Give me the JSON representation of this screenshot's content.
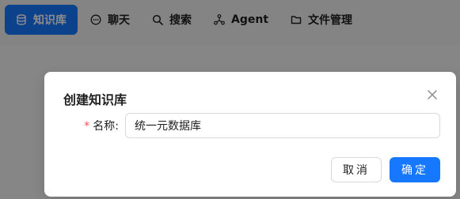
{
  "nav": {
    "items": [
      {
        "label": "知识库",
        "icon": "database-icon",
        "active": true
      },
      {
        "label": "聊天",
        "icon": "chat-icon",
        "active": false
      },
      {
        "label": "搜索",
        "icon": "search-icon",
        "active": false
      },
      {
        "label": "Agent",
        "icon": "agent-graph-icon",
        "active": false
      },
      {
        "label": "文件管理",
        "icon": "folder-icon",
        "active": false
      }
    ]
  },
  "modal": {
    "title": "创建知识库",
    "name_label": "名称",
    "name_value": "统一元数据库",
    "cancel_label": "取消",
    "ok_label": "确定"
  },
  "colors": {
    "accent": "#1677ff",
    "required": "#ff4d4f"
  }
}
